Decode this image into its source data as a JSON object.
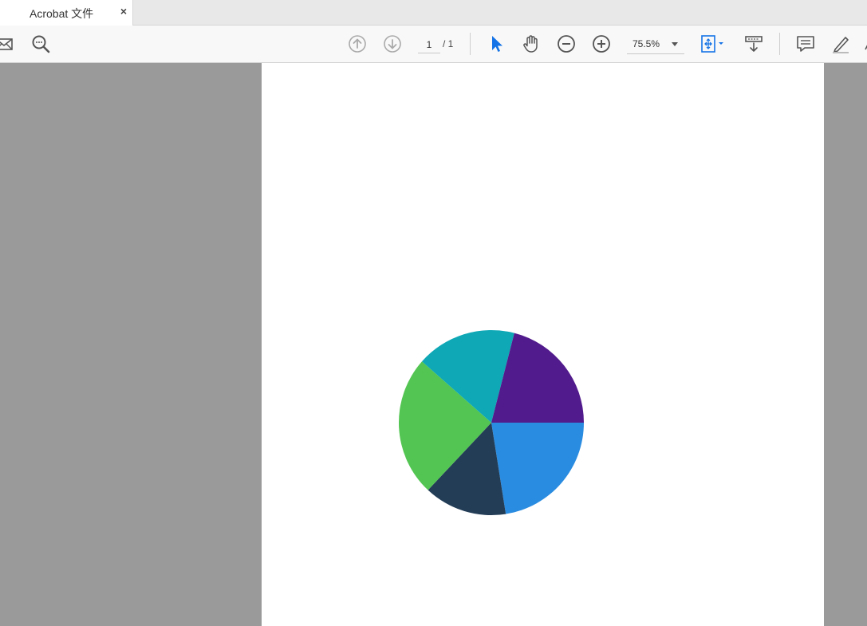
{
  "tab": {
    "title": "Acrobat 文件",
    "close_glyph": "×"
  },
  "toolbar": {
    "icons": [
      "mail-icon",
      "search-icon",
      "page-up-icon",
      "page-down-icon",
      "select-pointer-icon",
      "hand-icon",
      "zoom-out-icon",
      "zoom-in-icon",
      "fit-page-icon",
      "scroll-mode-icon",
      "comment-icon",
      "highlight-pen-icon"
    ],
    "page_current": "1",
    "page_total": "/ 1",
    "zoom": "75.5%",
    "accent": "#1473e6"
  },
  "chart_data": {
    "type": "pie",
    "title": "",
    "slices": [
      {
        "value": 22.5,
        "color": "#2a8ce0"
      },
      {
        "value": 14.5,
        "color": "#233d57"
      },
      {
        "value": 24.5,
        "color": "#53c552"
      },
      {
        "value": 17.5,
        "color": "#0ea8b6"
      },
      {
        "value": 21.0,
        "color": "#521b8d"
      }
    ]
  }
}
